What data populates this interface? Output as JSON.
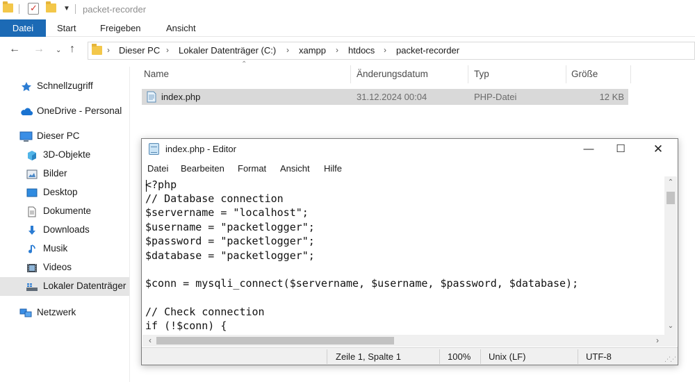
{
  "explorer": {
    "title": "packet-recorder",
    "ribbon_tabs": [
      "Datei",
      "Start",
      "Freigeben",
      "Ansicht"
    ],
    "breadcrumbs": [
      "Dieser PC",
      "Lokaler Datenträger (C:)",
      "xampp",
      "htdocs",
      "packet-recorder"
    ],
    "sidebar": [
      {
        "label": "Schnellzugriff",
        "icon": "star-icon"
      },
      {
        "label": "OneDrive - Personal",
        "icon": "cloud-icon"
      },
      {
        "label": "Dieser PC",
        "icon": "computer-icon"
      },
      {
        "label": "3D-Objekte",
        "icon": "cube-icon"
      },
      {
        "label": "Bilder",
        "icon": "pictures-icon"
      },
      {
        "label": "Desktop",
        "icon": "desktop-icon"
      },
      {
        "label": "Dokumente",
        "icon": "document-icon"
      },
      {
        "label": "Downloads",
        "icon": "download-icon"
      },
      {
        "label": "Musik",
        "icon": "music-icon"
      },
      {
        "label": "Videos",
        "icon": "video-icon"
      },
      {
        "label": "Lokaler Datenträger",
        "icon": "drive-icon"
      },
      {
        "label": "Netzwerk",
        "icon": "network-icon"
      }
    ],
    "columns": [
      "Name",
      "Änderungsdatum",
      "Typ",
      "Größe"
    ],
    "files": [
      {
        "name": "index.php",
        "date": "31.12.2024 00:04",
        "type": "PHP-Datei",
        "size": "12 KB"
      }
    ]
  },
  "notepad": {
    "title": "index.php - Editor",
    "menu": [
      "Datei",
      "Bearbeiten",
      "Format",
      "Ansicht",
      "Hilfe"
    ],
    "lines": [
      "<?php",
      "// Database connection",
      "$servername = \"localhost\";",
      "$username = \"packetlogger\";",
      "$password = \"packetlogger\";",
      "$database = \"packetlogger\";",
      "",
      "$conn = mysqli_connect($servername, $username, $password, $database);",
      "",
      "// Check connection",
      "if (!$conn) {"
    ],
    "status": {
      "position": "Zeile 1, Spalte 1",
      "zoom": "100%",
      "line_ending": "Unix (LF)",
      "encoding": "UTF-8"
    }
  },
  "colors": {
    "accent": "#1c6ab5",
    "folder": "#f3c74a",
    "selection": "#d9d9d9"
  }
}
